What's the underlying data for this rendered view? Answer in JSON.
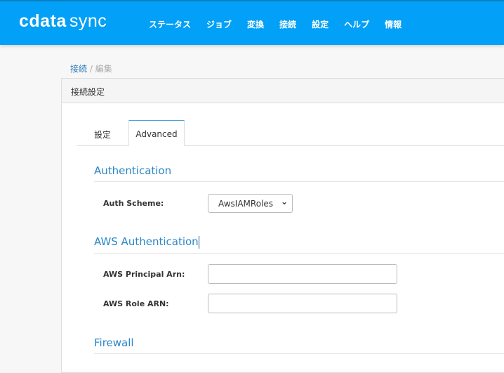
{
  "header": {
    "logo_left": "cdata",
    "logo_right": "sync",
    "nav": [
      "ステータス",
      "ジョブ",
      "変換",
      "接続",
      "設定",
      "ヘルプ",
      "情報"
    ]
  },
  "breadcrumb": {
    "link": "接続",
    "separator": "/",
    "current": "編集"
  },
  "panel": {
    "title": "接続設定"
  },
  "tabs": [
    {
      "label": "設定"
    },
    {
      "label": "Advanced",
      "active": true
    }
  ],
  "sections": {
    "auth": {
      "title": "Authentication",
      "auth_scheme_label": "Auth Scheme:",
      "auth_scheme_value": "AwsIAMRoles"
    },
    "aws": {
      "title": "AWS Authentication",
      "principal_label": "AWS Principal Arn:",
      "principal_value": "",
      "role_label": "AWS Role ARN:",
      "role_value": ""
    },
    "firewall": {
      "title": "Firewall"
    }
  }
}
